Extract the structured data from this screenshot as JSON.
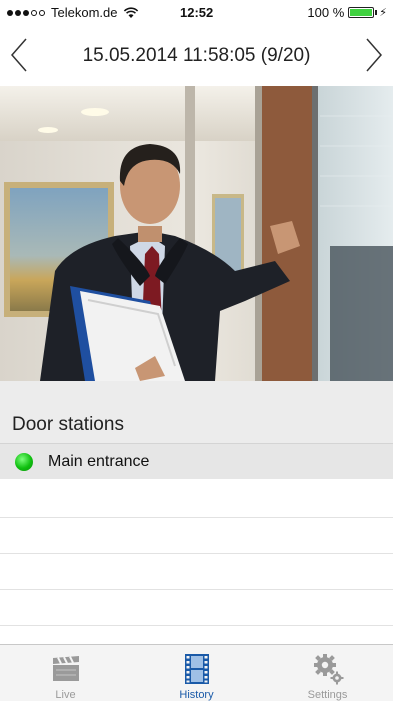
{
  "status_bar": {
    "carrier": "Telekom.de",
    "time": "12:52",
    "battery": "100 %",
    "battery_level": 1.0,
    "signal_bars_filled": 3,
    "signal_bars_total": 5
  },
  "nav": {
    "title": "15.05.2014 11:58:05 (9/20)",
    "prev_icon": "chevron-left-icon",
    "next_icon": "chevron-right-icon"
  },
  "snapshot": {
    "subject": "man in suit knocking on glass door"
  },
  "door_stations": {
    "header": "Door stations",
    "items": [
      {
        "label": "Main entrance",
        "status": "online",
        "status_color": "#1ec41e",
        "selected": true
      }
    ]
  },
  "tabs": [
    {
      "label": "Live",
      "icon": "clapperboard-icon",
      "active": false
    },
    {
      "label": "History",
      "icon": "film-strip-icon",
      "active": true
    },
    {
      "label": "Settings",
      "icon": "gears-icon",
      "active": false
    }
  ],
  "colors": {
    "accent": "#1a5aa8",
    "inactive": "#9a9a9a",
    "online": "#1ec41e"
  }
}
